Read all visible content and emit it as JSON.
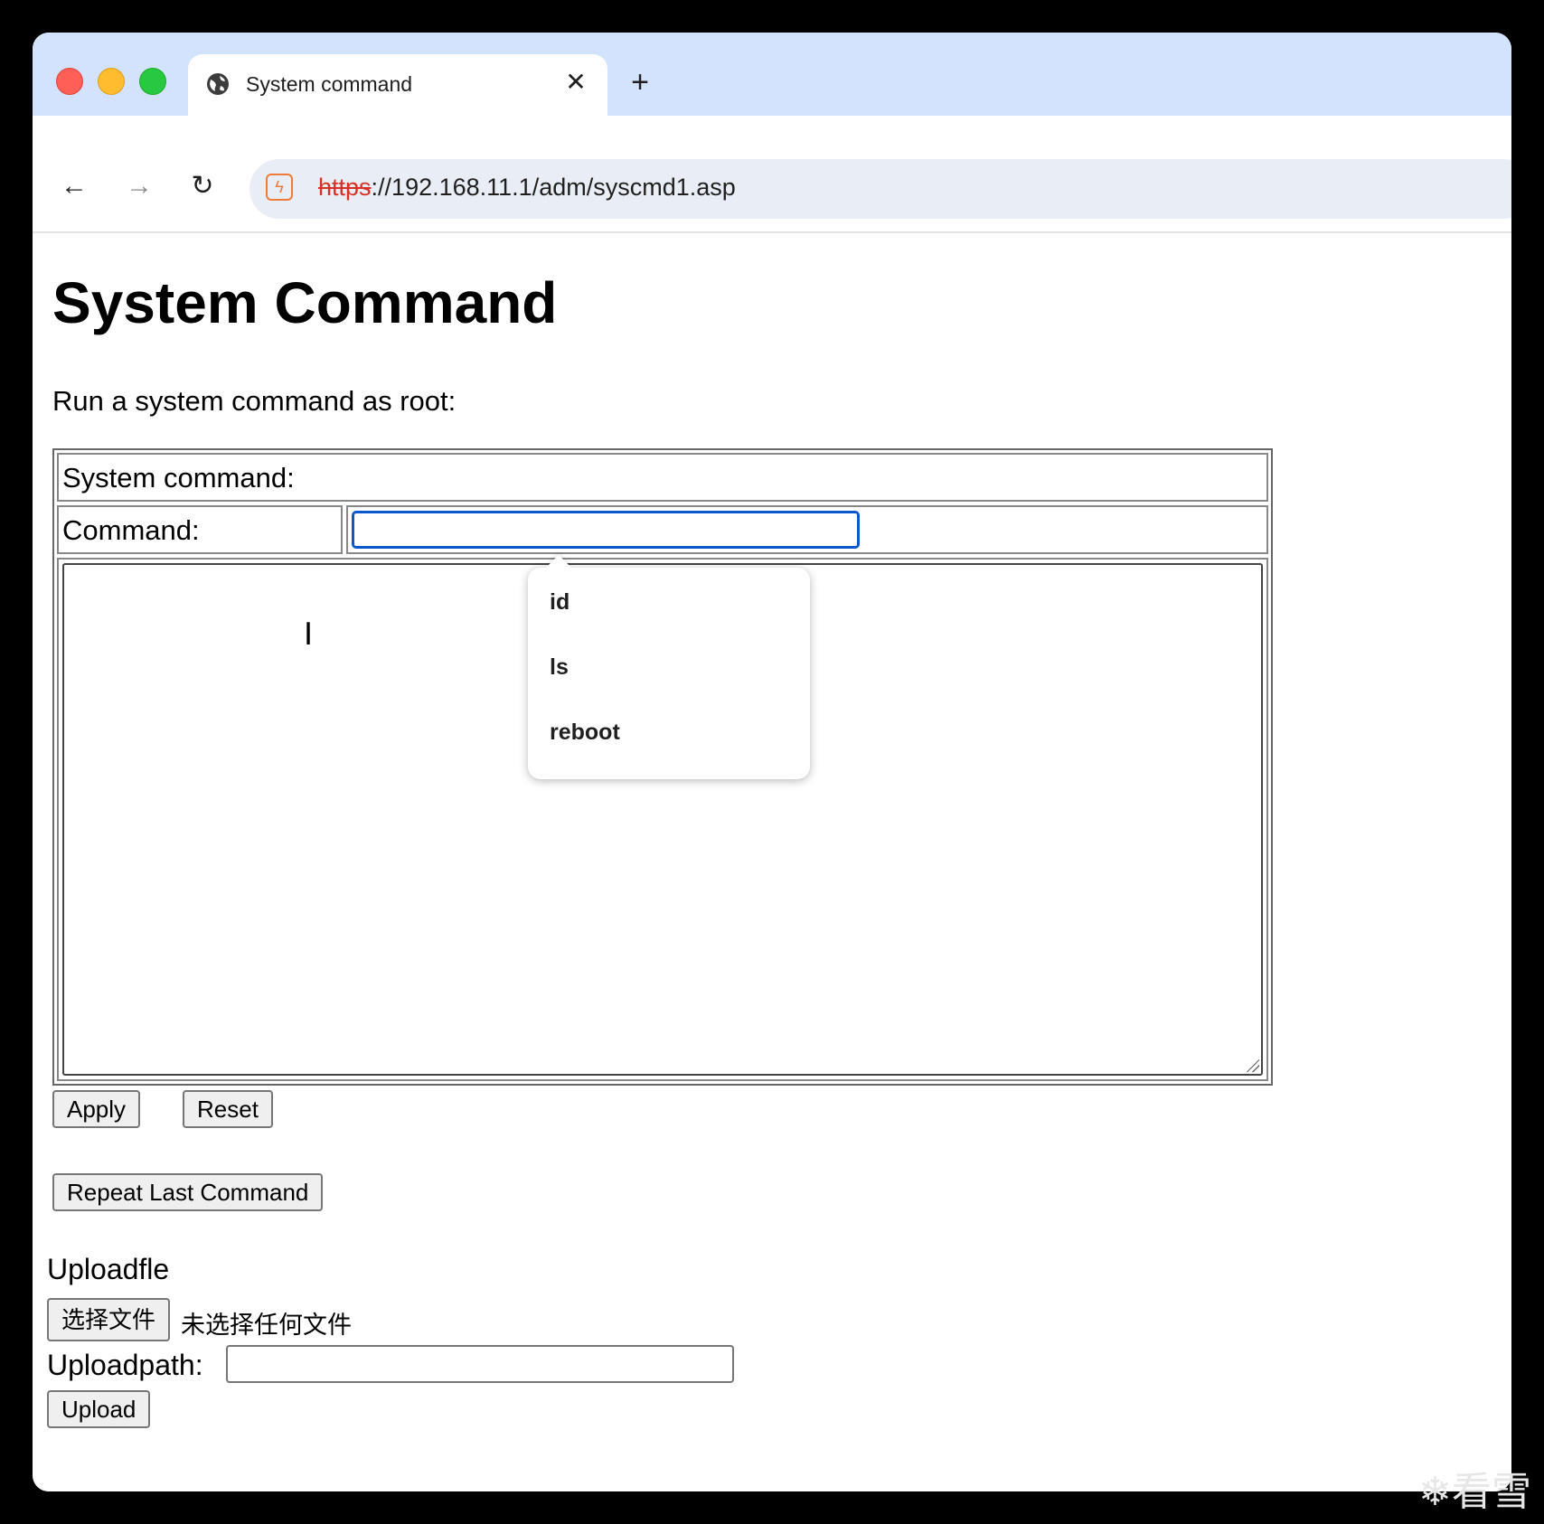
{
  "browser": {
    "tab_title": "System command",
    "url_scheme": "https",
    "url_rest": "://192.168.11.1/adm/syscmd1.asp",
    "icons": {
      "close": "close-icon",
      "new_tab": "plus-icon",
      "back": "arrow-left-icon",
      "forward": "arrow-right-icon",
      "reload": "reload-icon",
      "site_info": "not-secure-icon"
    }
  },
  "page": {
    "title": "System Command",
    "intro": "Run a system command as root:",
    "table_header": "System command:",
    "command_label": "Command:",
    "command_value": "",
    "output_value": "",
    "apply_label": "Apply",
    "reset_label": "Reset",
    "repeat_label": "Repeat Last Command",
    "upload_label": "Uploadfle",
    "choose_file_label": "选择文件",
    "no_file_text": "未选择任何文件",
    "uploadpath_label": "Uploadpath:",
    "uploadpath_value": "",
    "upload_button_label": "Upload"
  },
  "autocomplete": {
    "items": [
      "id",
      "ls",
      "reboot"
    ]
  },
  "watermark": "看雪"
}
